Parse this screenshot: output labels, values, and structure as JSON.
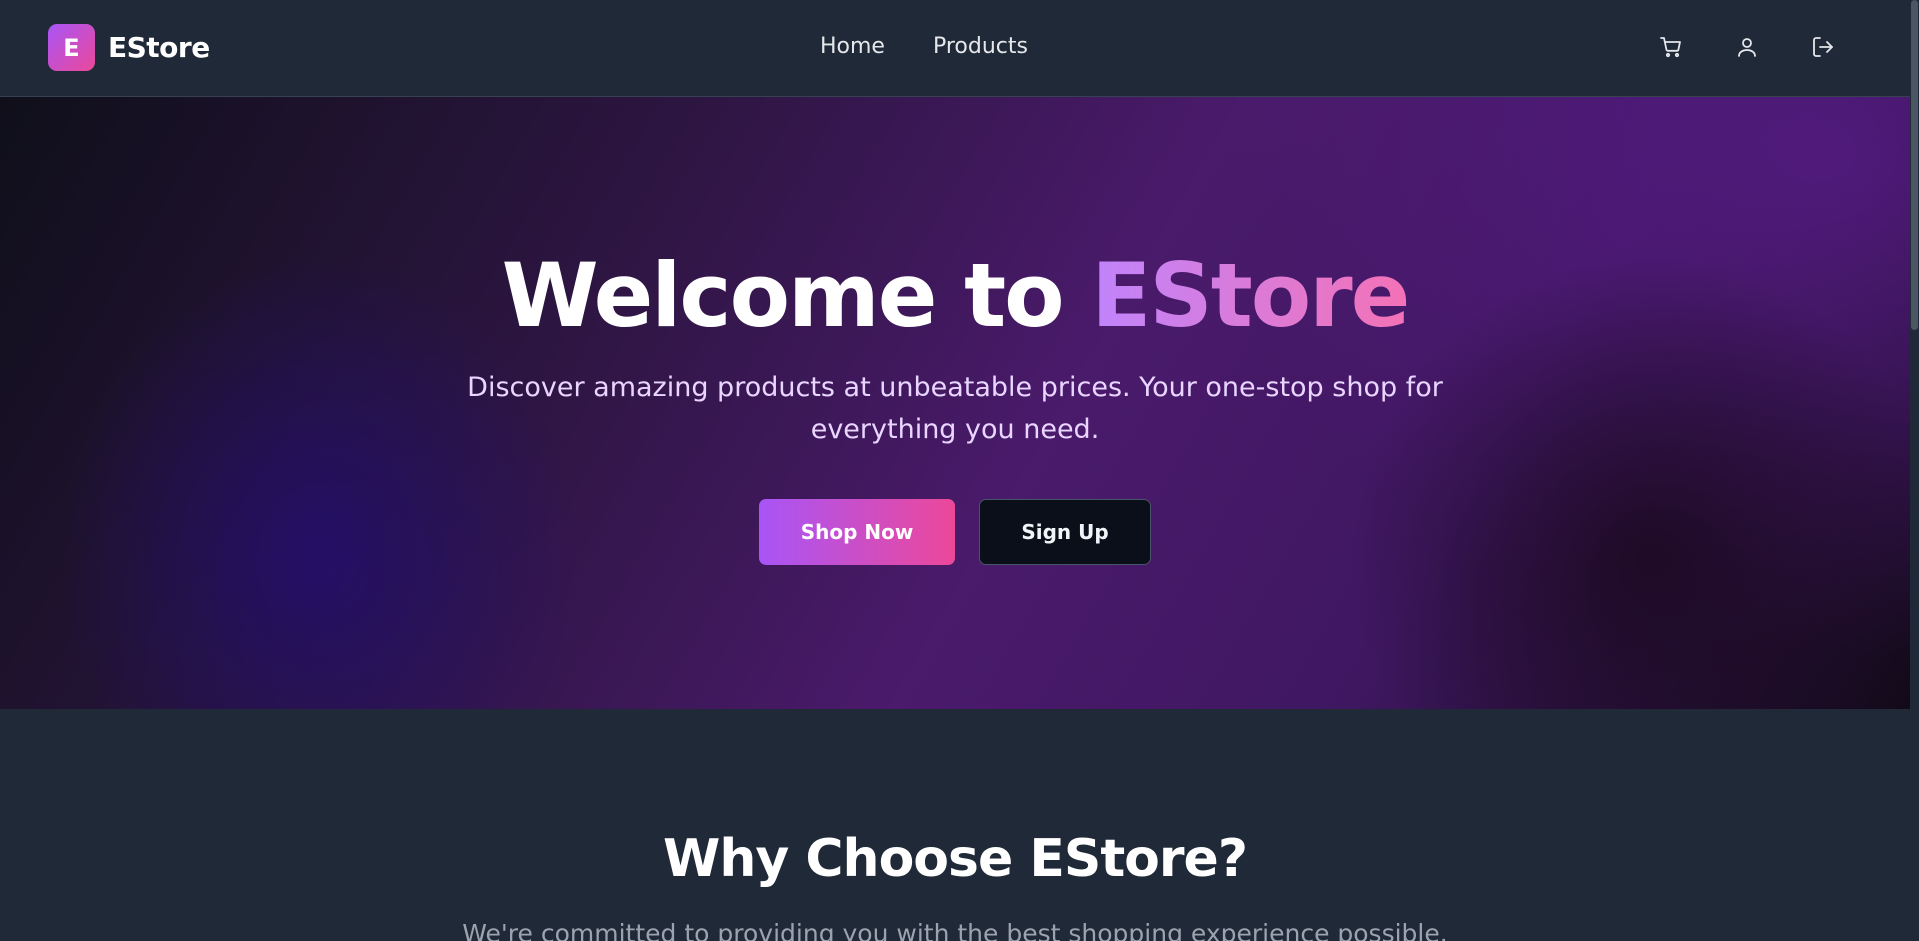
{
  "brand": {
    "badge": "E",
    "name": "EStore"
  },
  "nav": {
    "items": [
      {
        "label": "Home"
      },
      {
        "label": "Products"
      }
    ]
  },
  "header_icons": [
    "cart-icon",
    "user-icon",
    "logout-icon"
  ],
  "hero": {
    "title_prefix": "Welcome to ",
    "title_accent": "EStore",
    "subtitle": "Discover amazing products at unbeatable prices. Your one-stop shop for everything you need.",
    "primary_button": "Shop Now",
    "secondary_button": "Sign Up"
  },
  "features": {
    "title": "Why Choose EStore?",
    "subtitle": "We're committed to providing you with the best shopping experience possible."
  },
  "colors": {
    "accent_start": "#a855f7",
    "accent_end": "#ec4899",
    "background": "#1f2937"
  }
}
